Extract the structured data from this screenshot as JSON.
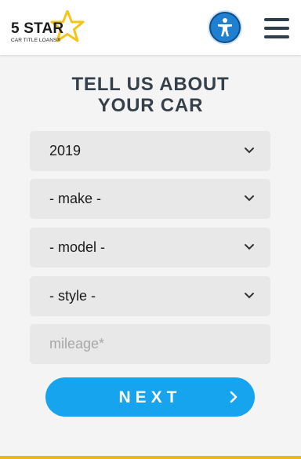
{
  "header": {
    "logo_name": "5 STAR",
    "logo_tagline": "CAR TITLE LOANS®",
    "accessibility_icon": "accessibility-icon",
    "menu_icon": "hamburger-menu-icon"
  },
  "form": {
    "title_line1": "TELL US ABOUT",
    "title_line2": "YOUR CAR",
    "year": {
      "value": "2019"
    },
    "make": {
      "value": "- make -"
    },
    "model": {
      "value": "- model -"
    },
    "style": {
      "value": "- style -"
    },
    "mileage": {
      "placeholder": "mileage*"
    },
    "next_label": "NEXT"
  },
  "colors": {
    "accent": "#17a4ee",
    "title": "#36404b",
    "star": "#f4c518",
    "footer_line": "#f2b323"
  }
}
